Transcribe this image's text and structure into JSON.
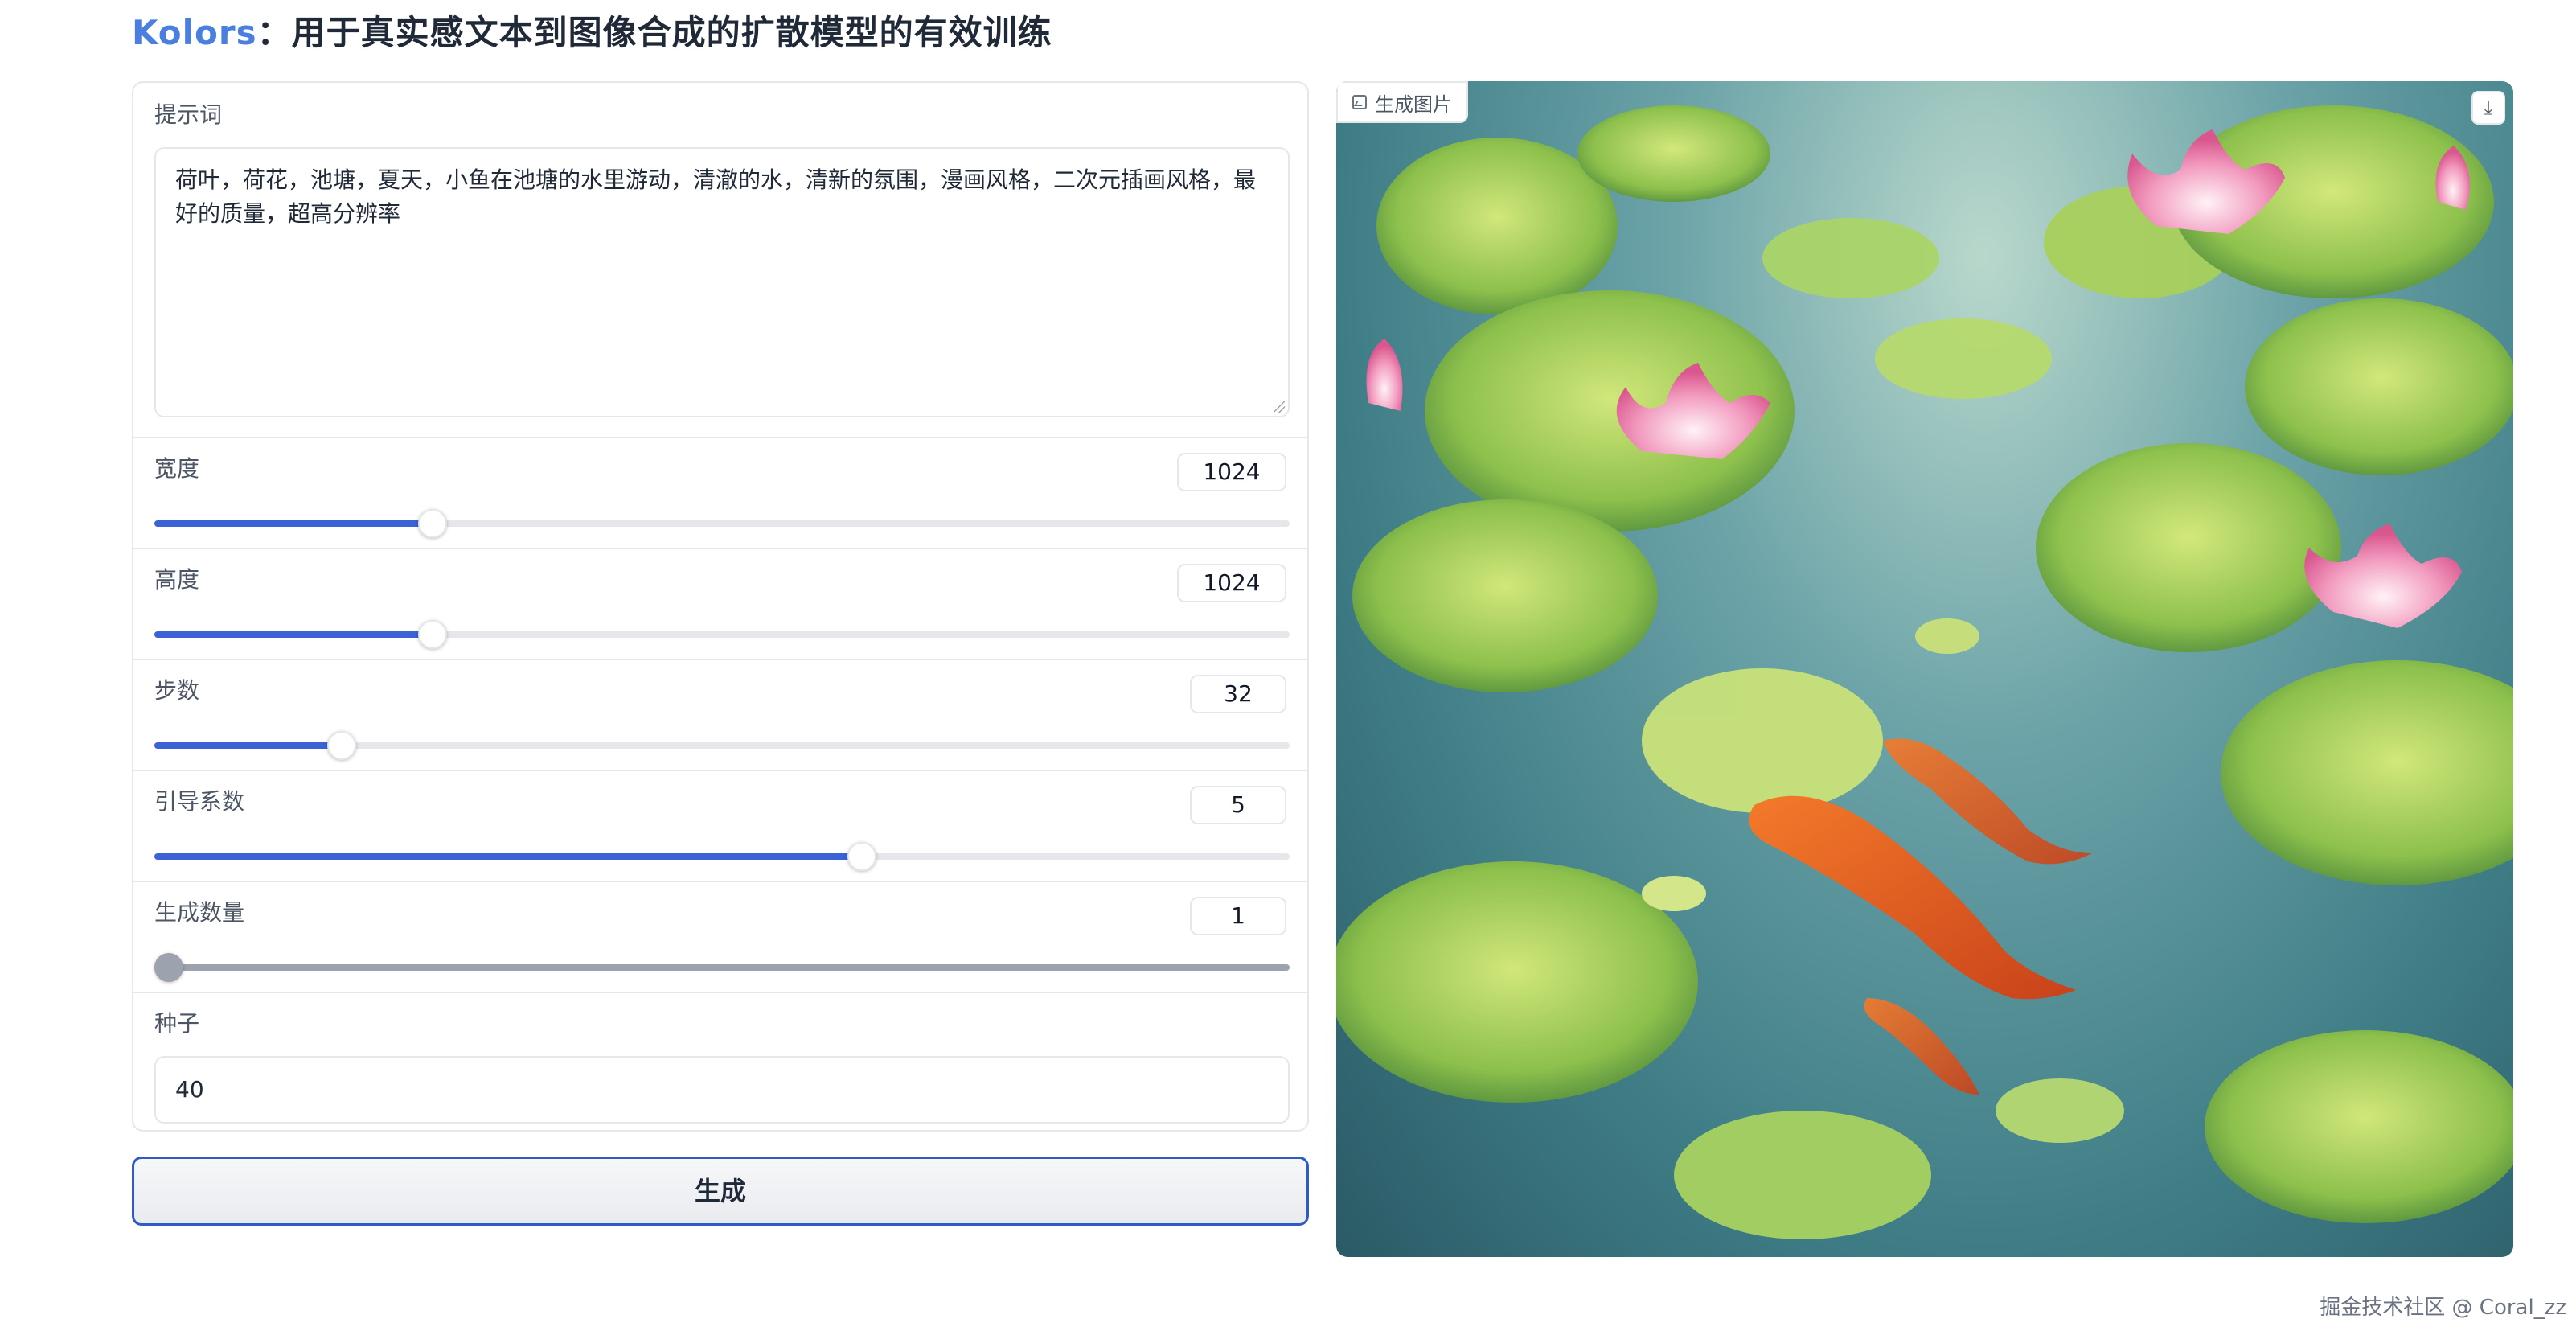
{
  "title": {
    "brand": "Kolors",
    "rest": "：用于真实感文本到图像合成的扩散模型的有效训练"
  },
  "prompt": {
    "label": "提示词",
    "value": "荷叶，荷花，池塘，夏天，小鱼在池塘的水里游动，清澈的水，清新的氛围，漫画风格，二次元插画风格，最好的质量，超高分辨率"
  },
  "sliders": [
    {
      "label": "宽度",
      "value": "1024",
      "fraction": 0.245
    },
    {
      "label": "高度",
      "value": "1024",
      "fraction": 0.245
    },
    {
      "label": "步数",
      "value": "32",
      "fraction": 0.165
    },
    {
      "label": "引导系数",
      "value": "5",
      "fraction": 0.623
    },
    {
      "label": "生成数量",
      "value": "1",
      "fraction": 0.0
    }
  ],
  "seed": {
    "label": "种子",
    "value": "40"
  },
  "generate_button": "生成",
  "image": {
    "label": "生成图片",
    "download_icon": "download-icon"
  },
  "watermark": "掘金技术社区 @ Coral_zz",
  "colors": {
    "accent": "#3b63d6",
    "brand": "#4a7fe0",
    "border": "#e5e7eb"
  }
}
